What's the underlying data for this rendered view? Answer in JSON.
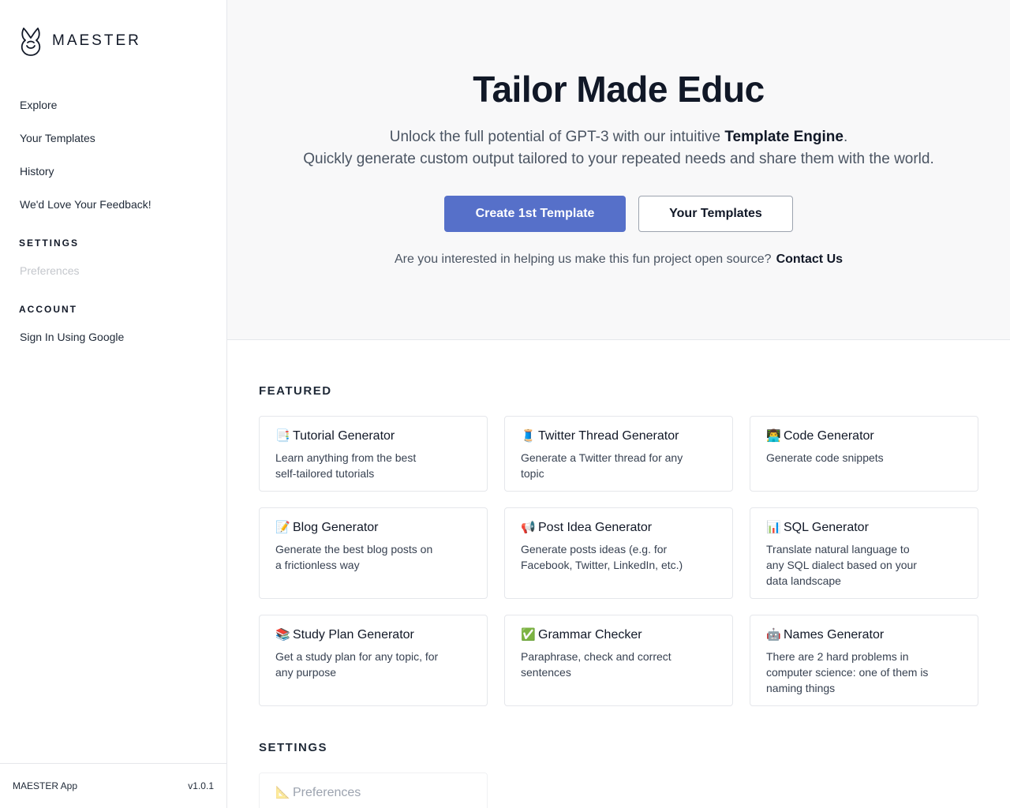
{
  "app": {
    "name": "MAESTER",
    "footer_name": "MAESTER App",
    "version": "v1.0.1"
  },
  "sidebar": {
    "items": [
      {
        "label": "Explore"
      },
      {
        "label": "Your Templates"
      },
      {
        "label": "History"
      },
      {
        "label": "We'd Love Your Feedback!"
      }
    ],
    "settings_header": "SETTINGS",
    "settings_items": [
      {
        "label": "Preferences",
        "disabled": true
      }
    ],
    "account_header": "ACCOUNT",
    "account_items": [
      {
        "label": "Sign In Using Google"
      }
    ]
  },
  "hero": {
    "title": "Tailor Made Educ",
    "subtitle_pre": "Unlock the full potential of GPT-3 with our intuitive ",
    "subtitle_bold": "Template Engine",
    "subtitle_post": ".",
    "subtitle_line2": "Quickly generate custom output tailored to your repeated needs and share them with the world.",
    "primary_button": "Create 1st Template",
    "secondary_button": "Your Templates",
    "contact_text": "Are you interested in helping us make this fun project open source?",
    "contact_link": "Contact Us"
  },
  "featured": {
    "header": "FEATURED",
    "cards": [
      {
        "emoji": "📑",
        "title": "Tutorial Generator",
        "desc": "Learn anything from the best self-tailored tutorials"
      },
      {
        "emoji": "🧵",
        "title": "Twitter Thread Generator",
        "desc": "Generate a Twitter thread for any topic"
      },
      {
        "emoji": "👨‍💻",
        "title": "Code Generator",
        "desc": "Generate code snippets"
      },
      {
        "emoji": "📝",
        "title": "Blog Generator",
        "desc": "Generate the best blog posts on a frictionless way"
      },
      {
        "emoji": "📢",
        "title": "Post Idea Generator",
        "desc": "Generate posts ideas (e.g. for Facebook, Twitter, LinkedIn, etc.)"
      },
      {
        "emoji": "📊",
        "title": "SQL Generator",
        "desc": "Translate natural language to any SQL dialect based on your data landscape"
      },
      {
        "emoji": "📚",
        "title": "Study Plan Generator",
        "desc": "Get a study plan for any topic, for any purpose"
      },
      {
        "emoji": "✅",
        "title": "Grammar Checker",
        "desc": "Paraphrase, check and correct sentences"
      },
      {
        "emoji": "🤖",
        "title": "Names Generator",
        "desc": "There are 2 hard problems in computer science: one of them is naming things"
      }
    ]
  },
  "settings_section": {
    "header": "SETTINGS",
    "cards": [
      {
        "emoji": "📐",
        "title": "Preferences",
        "disabled": true
      }
    ]
  },
  "colors": {
    "primary": "#5670c9",
    "hero_bg": "#f8f8f9",
    "border": "#e5e7eb"
  }
}
